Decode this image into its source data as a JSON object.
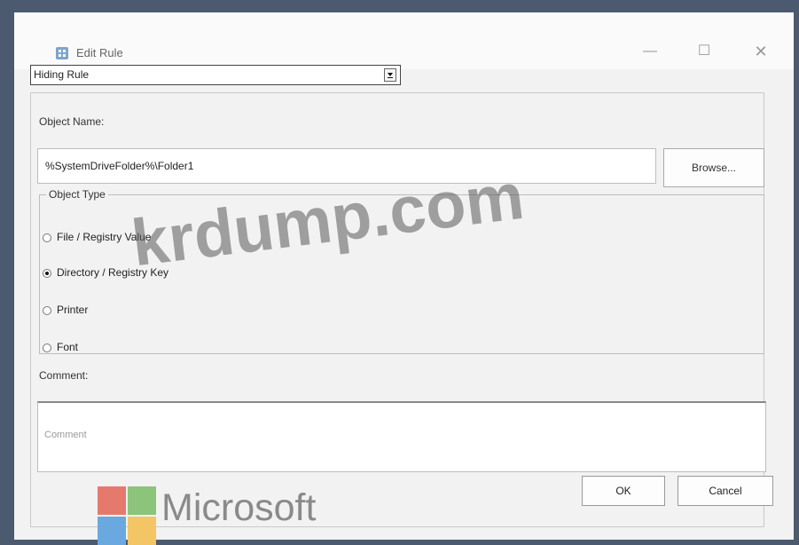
{
  "window": {
    "title": "Edit Rule",
    "controls": {
      "minimize": "—",
      "maximize": "☐",
      "close": "✕"
    }
  },
  "rule_type": {
    "selected": "Hiding Rule"
  },
  "object_name": {
    "label": "Object Name:",
    "value": "%SystemDriveFolder%\\Folder1",
    "browse_label": "Browse..."
  },
  "object_type": {
    "legend": "Object Type",
    "options": [
      {
        "label": "File / Registry Value",
        "checked": false
      },
      {
        "label": "Directory / Registry Key",
        "checked": true
      },
      {
        "label": "Printer",
        "checked": false
      },
      {
        "label": "Font",
        "checked": false
      }
    ]
  },
  "comment": {
    "label": "Comment:",
    "placeholder": "Comment"
  },
  "buttons": {
    "ok": "OK",
    "cancel": "Cancel"
  },
  "watermark": {
    "text": "krdump.com",
    "logo_text": "Microsoft"
  },
  "colors": {
    "background": "#4b5a6e",
    "dialog": "#f2f2f2",
    "ms_red": "#e57a6c",
    "ms_green": "#8bc47a",
    "ms_blue": "#6aa9e0",
    "ms_yellow": "#f4c565"
  }
}
